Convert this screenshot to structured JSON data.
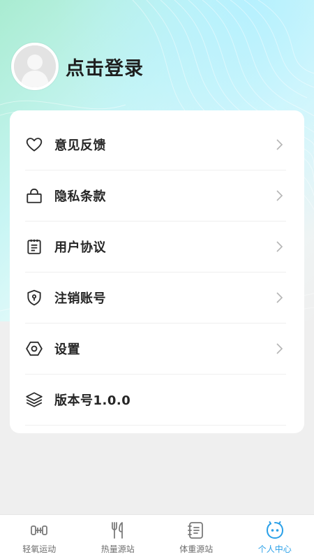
{
  "profile": {
    "login_text": "点击登录"
  },
  "menu": {
    "items": [
      {
        "label": "意见反馈",
        "icon": "heart-icon",
        "has_arrow": true
      },
      {
        "label": "隐私条款",
        "icon": "bag-icon",
        "has_arrow": true
      },
      {
        "label": "用户协议",
        "icon": "document-icon",
        "has_arrow": true
      },
      {
        "label": "注销账号",
        "icon": "shield-icon",
        "has_arrow": true
      },
      {
        "label": "设置",
        "icon": "hexagon-settings-icon",
        "has_arrow": true
      },
      {
        "label": "版本号1.0.0",
        "icon": "layers-icon",
        "has_arrow": false
      }
    ]
  },
  "tabbar": {
    "tabs": [
      {
        "label": "轻氧运动",
        "icon": "dumbbell-icon",
        "active": false
      },
      {
        "label": "热量源站",
        "icon": "fork-knife-icon",
        "active": false
      },
      {
        "label": "体重源站",
        "icon": "notebook-icon",
        "active": false
      },
      {
        "label": "个人中心",
        "icon": "face-icon",
        "active": true
      }
    ]
  },
  "colors": {
    "accent": "#2aa0e8",
    "text_primary": "#262626",
    "tab_inactive": "#6d6d6d",
    "background": "#efefef"
  }
}
